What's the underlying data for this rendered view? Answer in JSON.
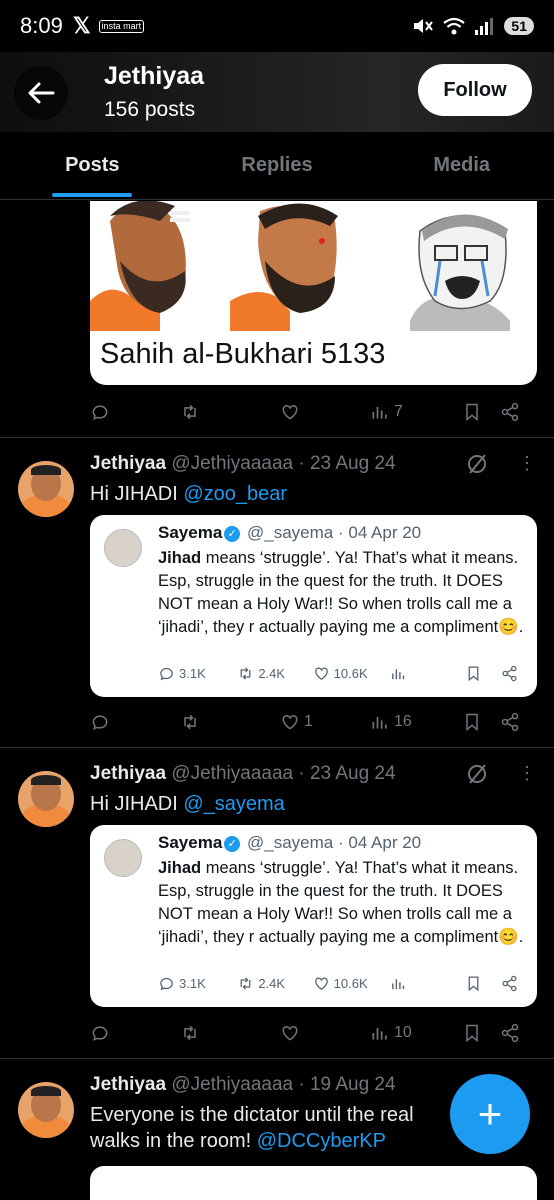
{
  "status": {
    "time": "8:09",
    "x_logo": "𝕏",
    "insta_label": "insta mart",
    "battery": "51"
  },
  "header": {
    "name": "Jethiyaa",
    "posts": "156 posts",
    "follow_label": "Follow"
  },
  "tabs": [
    {
      "label": "Posts",
      "active": true
    },
    {
      "label": "Replies",
      "active": false
    },
    {
      "label": "Media",
      "active": false
    }
  ],
  "meme": {
    "caption": "Sahih al-Bukhari 5133",
    "views": "7"
  },
  "tweets": [
    {
      "name": "Jethiyaa",
      "handle": "@Jethiyaaaaa · 23 Aug 24",
      "text_prefix": "Hi JIHADI ",
      "mention": "@zoo_bear",
      "quote": {
        "name": "Sayema",
        "handle": "@_sayema · 04 Apr 20",
        "text_bold": "Jihad",
        "text": " means ‘struggle’. Ya! That’s what it means. Esp, struggle in the quest for the truth. It DOES NOT mean a Holy War!! So when trolls call me a ‘jihadi’, they r actually paying me a compliment😊.",
        "replies": "3.1K",
        "retweets": "2.4K",
        "likes": "10.6K"
      },
      "likes": "1",
      "views": "16"
    },
    {
      "name": "Jethiyaa",
      "handle": "@Jethiyaaaaa · 23 Aug 24",
      "text_prefix": "Hi JIHADI ",
      "mention": "@_sayema",
      "quote": {
        "name": "Sayema",
        "handle": "@_sayema · 04 Apr 20",
        "text_bold": "Jihad",
        "text": " means ‘struggle’. Ya! That’s what it means. Esp, struggle in the quest for the truth. It DOES NOT mean a Holy War!! So when trolls call me a ‘jihadi’, they r actually paying me a compliment😊.",
        "replies": "3.1K",
        "retweets": "2.4K",
        "likes": "10.6K"
      },
      "likes": "",
      "views": "10"
    },
    {
      "name": "Jethiyaa",
      "handle": "@Jethiyaaaaa · 19 Aug 24",
      "text_line1": "Everyone is the dictator until the real",
      "text_line2_prefix": "walks in the room! ",
      "mention": "@DCCyberKP"
    }
  ],
  "fab_label": "+",
  "colors": {
    "accent": "#1d9bf0",
    "background": "#000000",
    "muted": "#71767b"
  }
}
